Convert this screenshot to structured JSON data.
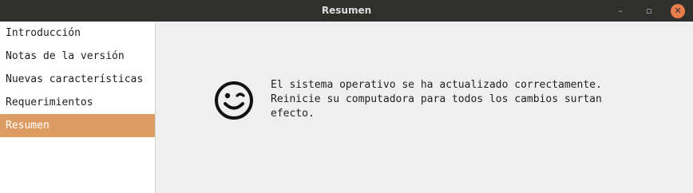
{
  "window": {
    "title": "Resumen"
  },
  "window_controls": {
    "minimize": "–",
    "maximize": "▫",
    "close": "✕"
  },
  "sidebar": {
    "items": [
      {
        "label": "Introducción",
        "active": false
      },
      {
        "label": "Notas de la versión",
        "active": false
      },
      {
        "label": "Nuevas características",
        "active": false
      },
      {
        "label": "Requerimientos",
        "active": false
      },
      {
        "label": "Resumen",
        "active": true
      }
    ]
  },
  "main": {
    "icon": "smile-icon",
    "message": "El sistema operativo se ha actualizado correctamente.\nReinicie su computadora para todos los cambios surtan\nefecto."
  },
  "colors": {
    "titlebar": "#2f2f2d",
    "accent": "#dd9c61",
    "close_button": "#e97c4b"
  }
}
